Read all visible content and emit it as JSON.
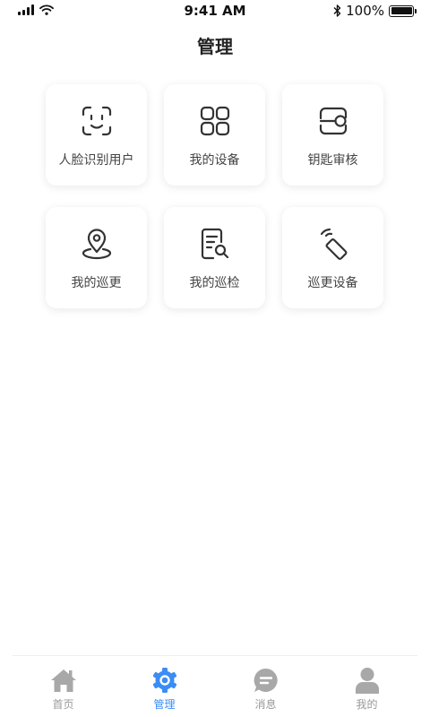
{
  "status_bar": {
    "time": "9:41 AM",
    "battery": "100%"
  },
  "header": {
    "title": "管理"
  },
  "grid": {
    "items": [
      {
        "label": "人脸识别用户",
        "icon": "face-scan-icon"
      },
      {
        "label": "我的设备",
        "icon": "grid-apps-icon"
      },
      {
        "label": "钥匙审核",
        "icon": "key-card-icon"
      },
      {
        "label": "我的巡更",
        "icon": "location-pin-icon"
      },
      {
        "label": "我的巡检",
        "icon": "document-search-icon"
      },
      {
        "label": "巡更设备",
        "icon": "wireless-device-icon"
      }
    ]
  },
  "tabbar": {
    "items": [
      {
        "label": "首页",
        "icon": "home-icon",
        "active": false
      },
      {
        "label": "管理",
        "icon": "gear-icon",
        "active": true
      },
      {
        "label": "消息",
        "icon": "message-icon",
        "active": false
      },
      {
        "label": "我的",
        "icon": "user-icon",
        "active": false
      }
    ]
  },
  "colors": {
    "accent": "#3b8cf5",
    "inactive": "#999999",
    "icon": "#333333"
  }
}
